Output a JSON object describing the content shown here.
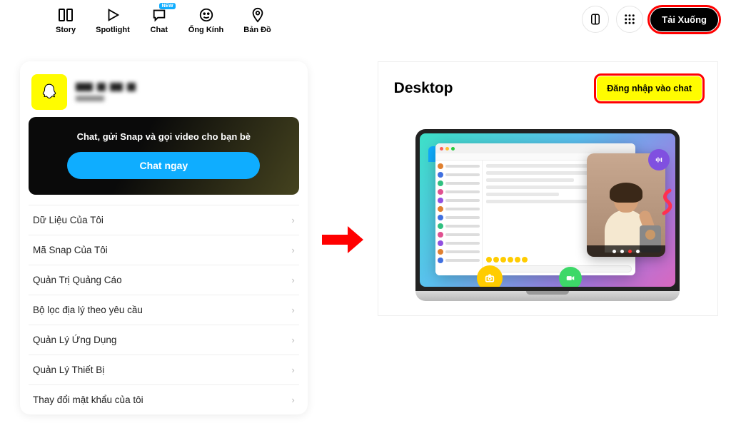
{
  "nav": {
    "story": "Story",
    "spotlight": "Spotlight",
    "chat": "Chat",
    "lens": "Ống Kính",
    "map": "Bản Đồ",
    "new_badge": "NEW",
    "download": "Tải Xuống"
  },
  "promo": {
    "text": "Chat, gửi Snap và gọi video cho bạn bè",
    "button": "Chat ngay"
  },
  "menu": [
    "Dữ Liệu Của Tôi",
    "Mã Snap Của Tôi",
    "Quản Trị Quảng Cáo",
    "Bộ lọc địa lý theo yêu cầu",
    "Quản Lý Ứng Dụng",
    "Quản Lý Thiết Bị",
    "Thay đổi mật khẩu của tôi"
  ],
  "right": {
    "title": "Desktop",
    "login_button": "Đăng nhập vào chat"
  }
}
